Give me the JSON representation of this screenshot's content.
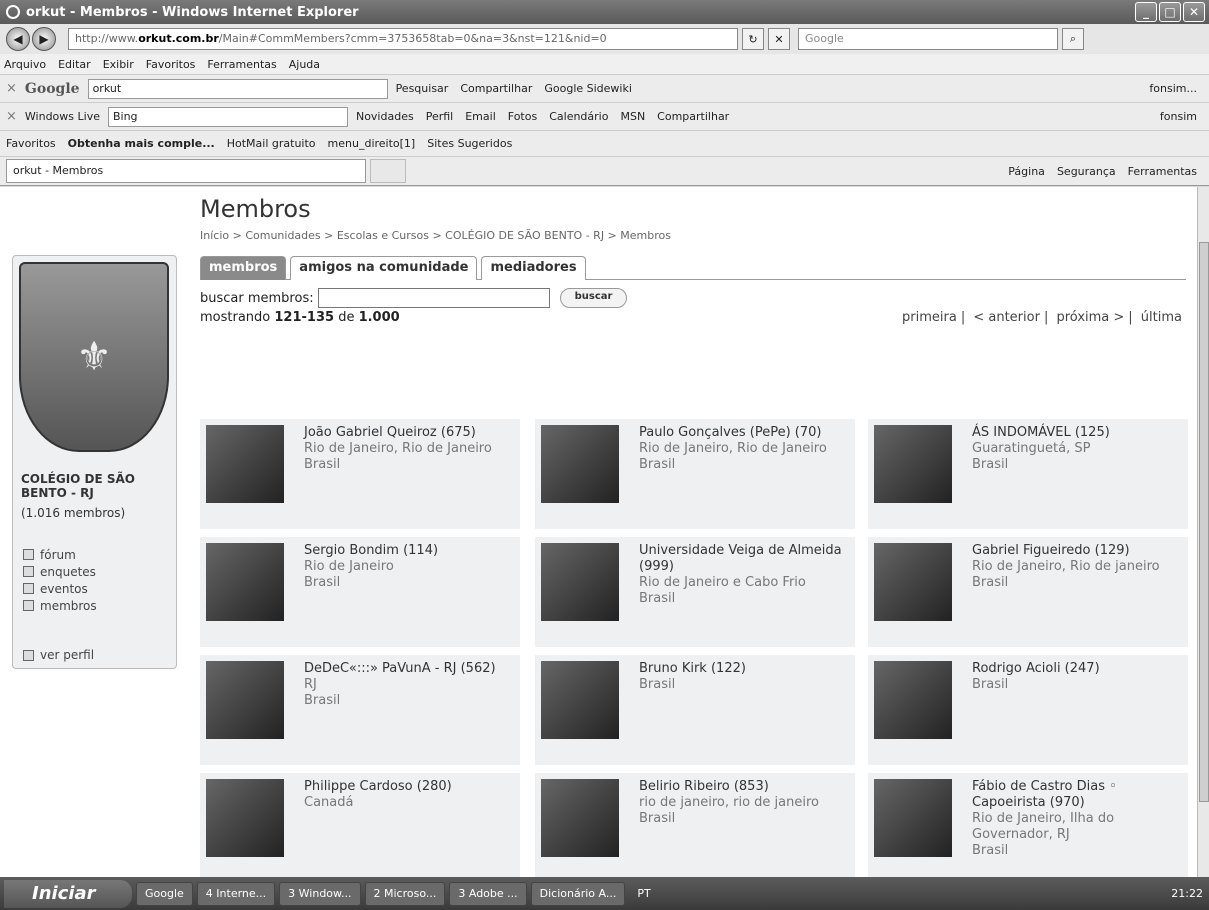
{
  "window": {
    "title": "orkut - Membros - Windows Internet Explorer",
    "url_prefix": "http://www.",
    "url_host": "orkut.com.br",
    "url_path": "/Main#CommMembers?cmm=3753658tab=0&na=3&nst=121&nid=0",
    "search_placeholder": "Google"
  },
  "menu": [
    "Arquivo",
    "Editar",
    "Exibir",
    "Favoritos",
    "Ferramentas",
    "Ajuda"
  ],
  "google_toolbar": {
    "logo": "Google",
    "query": "orkut",
    "items": [
      "Pesquisar",
      "Compartilhar",
      "Google Sidewiki",
      "fonsim..."
    ]
  },
  "live_toolbar": {
    "logo": "Windows Live",
    "query": "Bing",
    "items": [
      "Novidades",
      "Perfil",
      "Email",
      "Fotos",
      "Calendário",
      "MSN",
      "Compartilhar",
      "fonsim"
    ]
  },
  "favorites_bar": {
    "items": [
      "Favoritos",
      "Obtenha mais comple...",
      "HotMail gratuito",
      "menu_direito[1]",
      "Sites Sugeridos"
    ]
  },
  "tabs_bar": {
    "tab_title": "orkut - Membros",
    "commands": [
      "Página",
      "Segurança",
      "Ferramentas"
    ]
  },
  "community": {
    "name": "COLÉGIO DE SÃO BENTO - RJ",
    "members": "(1.016 membros)",
    "links": [
      "fórum",
      "enquetes",
      "eventos",
      "membros"
    ],
    "profile_link": "ver perfil"
  },
  "page": {
    "title": "Membros",
    "breadcrumb": "Início > Comunidades > Escolas e Cursos > COLÉGIO DE SÃO BENTO - RJ > Membros",
    "tabs": [
      "membros",
      "amigos na comunidade",
      "mediadores"
    ],
    "search_label": "buscar membros:",
    "search_button": "buscar",
    "showing_prefix": "mostrando ",
    "showing_range": "121-135",
    "showing_mid": " de ",
    "showing_total": "1.000",
    "pager": [
      "primeira",
      "< anterior",
      "próxima >",
      "última"
    ]
  },
  "members": [
    {
      "name": "João Gabriel Queiroz (675)",
      "loc": "Rio de Janeiro, Rio de Janeiro",
      "country": "Brasil"
    },
    {
      "name": "Paulo Gonçalves (PePe) (70)",
      "loc": "Rio de Janeiro, Rio de Janeiro",
      "country": "Brasil"
    },
    {
      "name": "ÁS INDOMÁVEL (125)",
      "loc": "Guaratinguetá, SP",
      "country": "Brasil"
    },
    {
      "name": "Sergio Bondim (114)",
      "loc": "Rio de Janeiro",
      "country": "Brasil"
    },
    {
      "name": "Universidade Veiga de Almeida (999)",
      "loc": "Rio de Janeiro e Cabo Frio",
      "country": "Brasil"
    },
    {
      "name": "Gabriel Figueiredo (129)",
      "loc": "Rio de Janeiro, Rio de janeiro",
      "country": "Brasil"
    },
    {
      "name": "DeDeC«:::» PaVunA - RJ (562)",
      "loc": "RJ",
      "country": "Brasil"
    },
    {
      "name": "Bruno Kirk (122)",
      "loc": "",
      "country": "Brasil"
    },
    {
      "name": "Rodrigo Acioli (247)",
      "loc": "",
      "country": "Brasil"
    },
    {
      "name": "Philippe Cardoso (280)",
      "loc": "",
      "country": "Canadá"
    },
    {
      "name": "Belirio Ribeiro (853)",
      "loc": "rio de janeiro, rio de janeiro",
      "country": "Brasil"
    },
    {
      "name": "Fábio de Castro Dias ◦ Capoeirista (970)",
      "loc": "Rio de Janeiro, Ilha do Governador, RJ",
      "country": "Brasil"
    }
  ],
  "taskbar": {
    "start": "Iniciar",
    "items": [
      "Google",
      "4 Interne...",
      "3 Window...",
      "2 Microso...",
      "3 Adobe ...",
      "Dicionário A..."
    ],
    "lang": "PT",
    "clock": "21:22"
  }
}
